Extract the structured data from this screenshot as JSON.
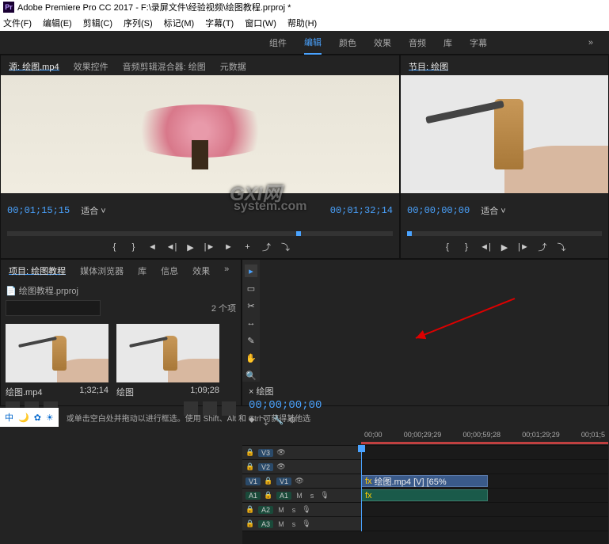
{
  "app": {
    "name": "Adobe Premiere Pro CC 2017",
    "title_suffix": "F:\\录屏文件\\经验视频\\绘图教程.prproj *"
  },
  "menu": [
    "文件(F)",
    "编辑(E)",
    "剪辑(C)",
    "序列(S)",
    "标记(M)",
    "字幕(T)",
    "窗口(W)",
    "帮助(H)"
  ],
  "workspaces": {
    "items": [
      "组件",
      "编辑",
      "颜色",
      "效果",
      "音频",
      "库",
      "字幕"
    ],
    "active_index": 1,
    "more": "»"
  },
  "source_panel": {
    "tabs": [
      "源: 绘图.mp4",
      "效果控件",
      "音频剪辑混合器: 绘图",
      "元数据"
    ],
    "active_tab": 0,
    "timecode_in": "00;01;15;15",
    "zoom": "适合",
    "timecode_out": "00;01;32;14",
    "sub": " system.com"
  },
  "program_panel": {
    "tabs": [
      "节目: 绘图"
    ],
    "timecode_in": "00;00;00;00",
    "zoom": "适合",
    "timecode_out": ""
  },
  "project_panel": {
    "tabs": [
      "项目: 绘图教程",
      "媒体浏览器",
      "库",
      "信息",
      "效果"
    ],
    "active_tab": 0,
    "project_name": "绘图教程.prproj",
    "more": "»",
    "search_placeholder": "",
    "item_count": "2 个项",
    "bins": [
      {
        "name": "绘图.mp4",
        "duration": "1;32;14"
      },
      {
        "name": "绘图",
        "duration": "1;09;28"
      }
    ]
  },
  "timeline": {
    "sequence_name": "× 绘图",
    "timecode": "00;00;00;00",
    "ruler": [
      "00;00",
      "00;00;29;29",
      "00;00;59;28",
      "00;01;29;29",
      "00;01;5"
    ],
    "tracks": {
      "video": [
        "V3",
        "V2",
        "V1"
      ],
      "audio": [
        "A1",
        "A2",
        "A3"
      ]
    },
    "source_patches": {
      "v": "V1",
      "a": "A1"
    },
    "clip_video": "绘图.mp4 [V] [65%",
    "clip_audio": "",
    "track_icons": {
      "lock": "🔒",
      "eye": "👁",
      "mute": "M",
      "solo": "s",
      "mic": "🎙",
      "fx": "fx"
    },
    "tools": [
      "▸",
      "▭",
      "✂",
      "↔",
      "✎",
      "✋",
      "🔍"
    ]
  },
  "transport": {
    "btns": [
      "{",
      "}",
      "◄",
      "◄|",
      "▶",
      "|►",
      "►",
      "+",
      "⤴",
      "⤵"
    ]
  },
  "status": {
    "text": "或单击空白处并拖动以进行框选。使用 Shift、Alt 和 Ctrl 可获得其他选",
    "icons": [
      "中",
      "🌙",
      "✿",
      "☀"
    ]
  },
  "watermark": {
    "line1": "GXI网"
  }
}
